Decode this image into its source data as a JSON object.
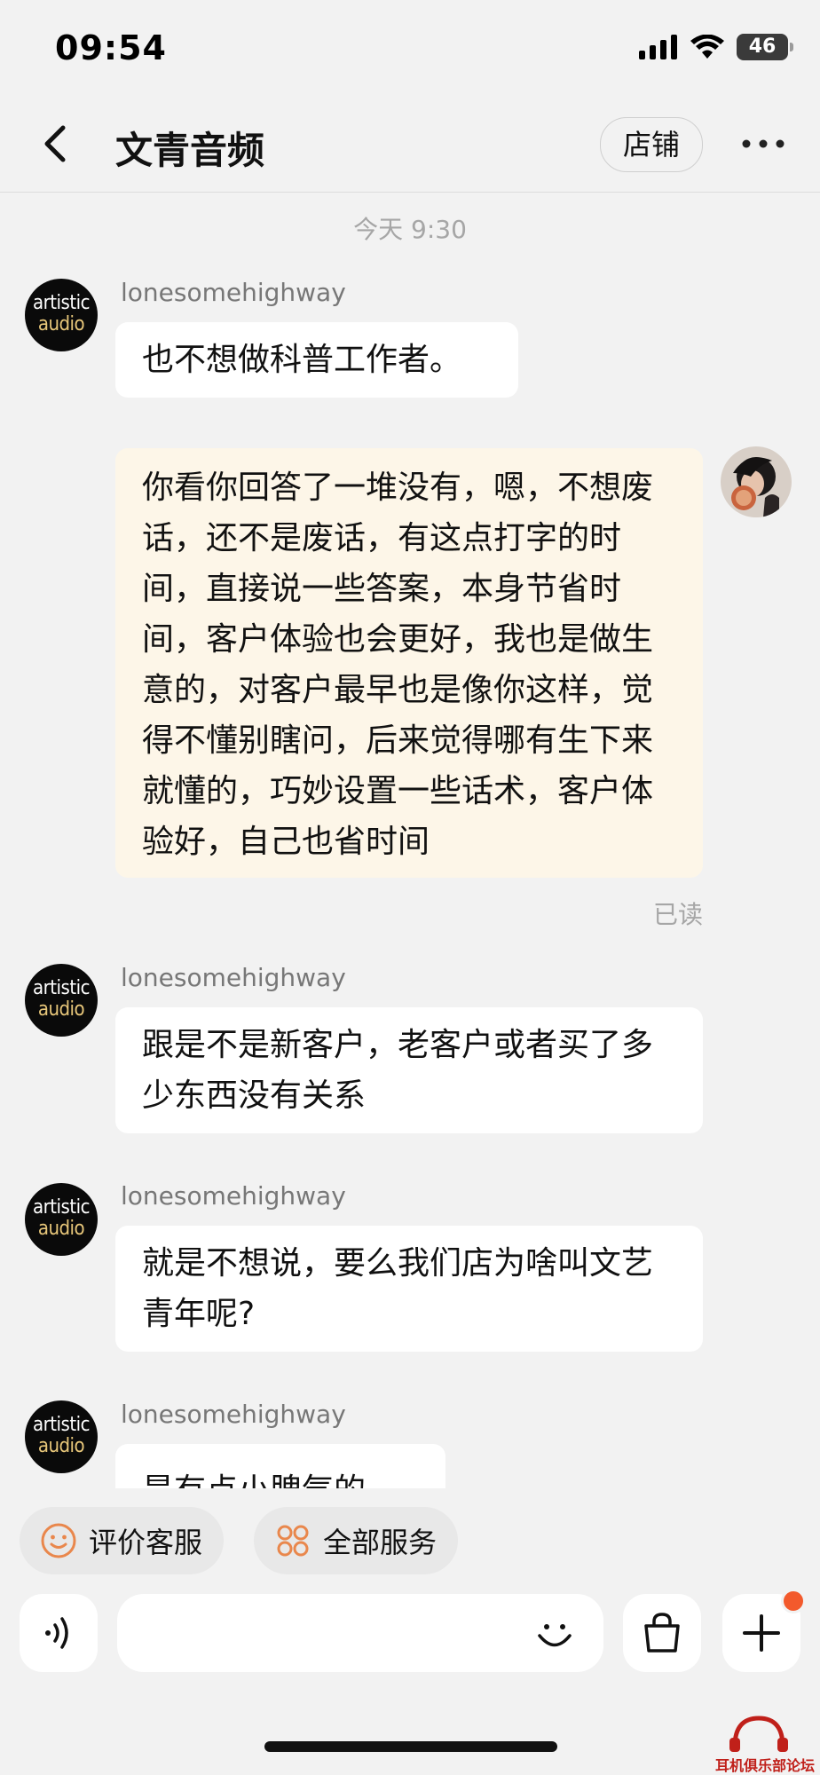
{
  "status_bar": {
    "time": "09:54",
    "battery": "46"
  },
  "header": {
    "back_icon": "chevron-left-icon",
    "title": "文青音频",
    "store_label": "店铺",
    "more_icon": "more-dots-icon"
  },
  "chat": {
    "timestamp": "今天 9:30",
    "shop_avatar": {
      "line1": "artistic",
      "line2": "audio"
    },
    "messages": [
      {
        "sender": "lonesomehighway",
        "text": "也不想做科普工作者。"
      },
      {
        "sender": "me",
        "text": "你看你回答了一堆没有，嗯，不想废话，还不是废话，有这点打字的时间，直接说一些答案，本身节省时间，客户体验也会更好，我也是做生意的，对客户最早也是像你这样，觉得不懂别瞎问，后来觉得哪有生下来就懂的，巧妙设置一些话术，客户体验好，自己也省时间",
        "status": "已读"
      },
      {
        "sender": "lonesomehighway",
        "text": "跟是不是新客户，老客户或者买了多少东西没有关系"
      },
      {
        "sender": "lonesomehighway",
        "text": "就是不想说，要么我们店为啥叫文艺青年呢?"
      },
      {
        "sender": "lonesomehighway",
        "text": "是有点小脾气的"
      }
    ]
  },
  "quick_actions": [
    {
      "label": "评价客服",
      "icon": "smiley-icon"
    },
    {
      "label": "全部服务",
      "icon": "services-grid-icon"
    }
  ],
  "input_bar": {
    "voice_icon": "voice-icon",
    "placeholder": "",
    "emoji_icon": "emoji-icon",
    "bag_icon": "shopping-bag-icon",
    "plus_icon": "plus-icon"
  },
  "watermark": {
    "text": "耳机俱乐部论坛"
  },
  "colors": {
    "background": "#f2f2f2",
    "incoming_bubble": "#ffffff",
    "outgoing_bubble": "#fdf6e8",
    "accent_orange": "#e9874c",
    "badge": "#f35a2c"
  }
}
